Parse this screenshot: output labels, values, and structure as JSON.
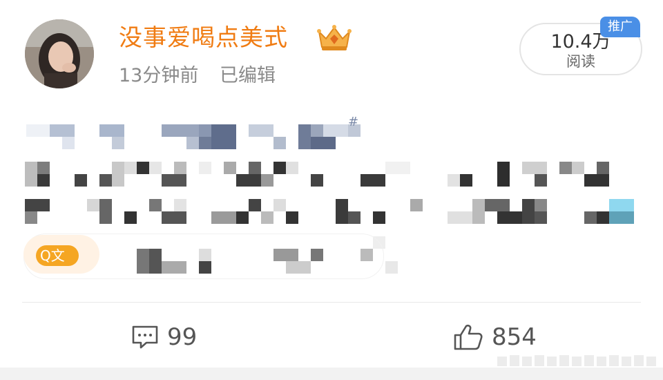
{
  "post": {
    "username": "没事爱喝点美式",
    "time": "13分钟前",
    "edited": "已编辑",
    "reads": {
      "count": "10.4万",
      "label": "阅读",
      "badge": "推广"
    },
    "chip_label": "Q文"
  },
  "actions": {
    "comments": "99",
    "likes": "854"
  },
  "colors": {
    "username": "#f07c13",
    "promo_badge": "#4a8fe6",
    "chip": "#f5a623"
  }
}
